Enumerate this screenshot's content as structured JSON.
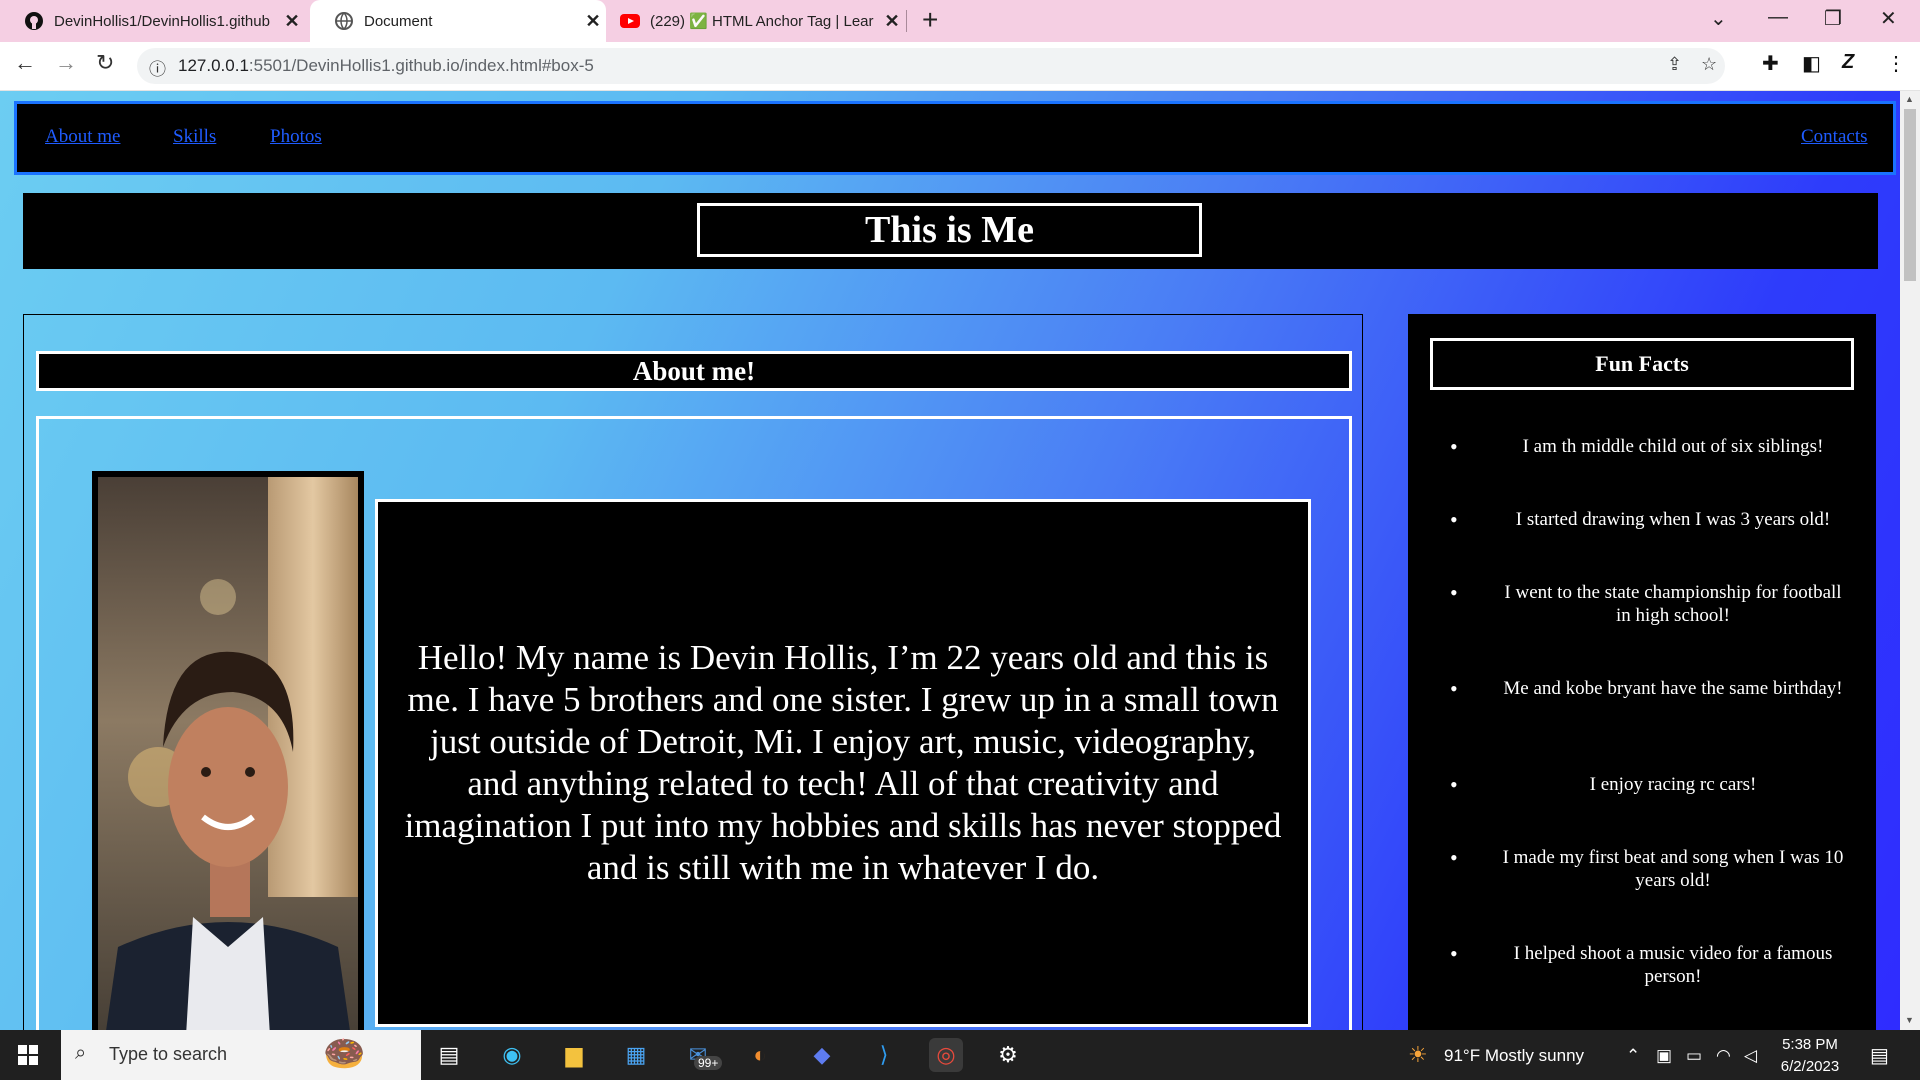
{
  "browser": {
    "tabs": [
      {
        "title": "DevinHollis1/DevinHollis1.github",
        "icon": "github-icon",
        "active": false
      },
      {
        "title": "Document",
        "icon": "globe-icon",
        "active": true
      },
      {
        "title": "(229) ✅ HTML Anchor Tag | Lear",
        "icon": "youtube-icon",
        "active": false
      }
    ],
    "new_tab": "+",
    "address": {
      "host": "127.0.0.1",
      "path": ":5501/DevinHollis1.github.io/index.html#box-5"
    }
  },
  "nav": {
    "links": [
      "About me",
      "Skills",
      "Photos"
    ],
    "contacts": "Contacts"
  },
  "hero": {
    "title": "This is Me"
  },
  "about": {
    "heading": "About me!",
    "bio": "Hello! My name is Devin Hollis, I’m 22 years old and this is me. I have 5 brothers and one sister. I grew up in a small town just outside of Detroit, Mi. I enjoy art, music, videography, and anything related to tech! All of that creativity and imagination I put into my hobbies and skills has never stopped and is still with me in whatever I do."
  },
  "fun_facts": {
    "heading": "Fun Facts",
    "items": [
      "I am th middle child out of six siblings!",
      "I started drawing when I was 3 years old!",
      "I went to the state championship for football in high school!",
      "Me and kobe bryant have the same birthday!",
      "I enjoy racing rc cars!",
      "I made my first beat and song when I was 10 years old!",
      "I helped shoot a music video for a famous person!"
    ]
  },
  "taskbar": {
    "search_placeholder": "Type to search",
    "mail_badge": "99+",
    "weather": "91°F  Mostly sunny",
    "time": "5:38 PM",
    "date": "6/2/2023"
  }
}
